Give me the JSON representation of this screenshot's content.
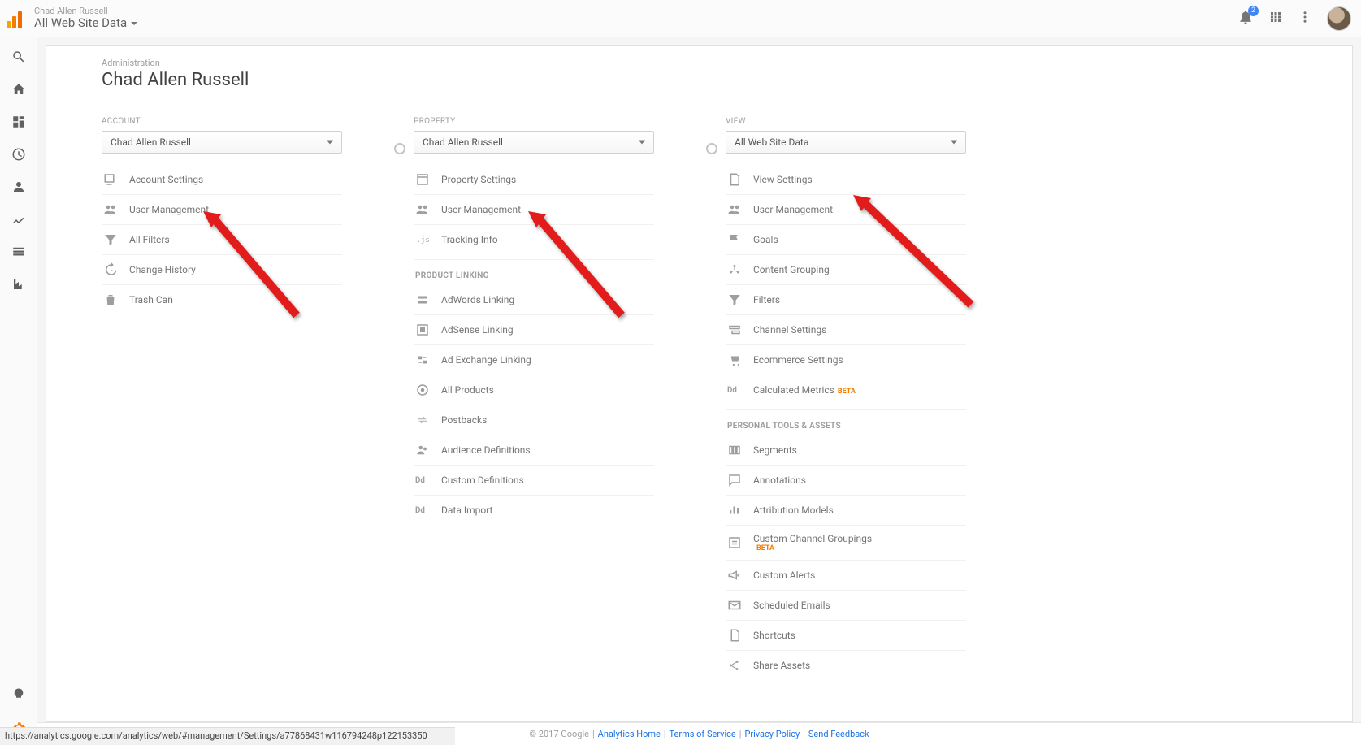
{
  "header": {
    "account_name": "Chad Allen Russell",
    "view_name": "All Web Site Data",
    "notification_count": "2"
  },
  "admin": {
    "breadcrumb": "Administration",
    "title": "Chad Allen Russell"
  },
  "account_col": {
    "label": "ACCOUNT",
    "selector": "Chad Allen Russell",
    "items": [
      {
        "icon": "settings-box",
        "label": "Account Settings"
      },
      {
        "icon": "people",
        "label": "User Management"
      },
      {
        "icon": "filter",
        "label": "All Filters"
      },
      {
        "icon": "history",
        "label": "Change History"
      },
      {
        "icon": "trash",
        "label": "Trash Can"
      }
    ]
  },
  "property_col": {
    "label": "PROPERTY",
    "selector": "Chad Allen Russell",
    "items": [
      {
        "icon": "property-settings",
        "label": "Property Settings"
      },
      {
        "icon": "people",
        "label": "User Management"
      },
      {
        "icon": "code-js",
        "label": "Tracking Info"
      }
    ],
    "section_heading": "PRODUCT LINKING",
    "linking_items": [
      {
        "icon": "adwords",
        "label": "AdWords Linking"
      },
      {
        "icon": "adsense",
        "label": "AdSense Linking"
      },
      {
        "icon": "exchange",
        "label": "Ad Exchange Linking"
      },
      {
        "icon": "all-products",
        "label": "All Products"
      },
      {
        "icon": "postbacks",
        "label": "Postbacks"
      },
      {
        "icon": "audience",
        "label": "Audience Definitions"
      },
      {
        "icon": "dd",
        "label": "Custom Definitions"
      },
      {
        "icon": "dd",
        "label": "Data Import"
      }
    ]
  },
  "view_col": {
    "label": "VIEW",
    "selector": "All Web Site Data",
    "items": [
      {
        "icon": "view-settings",
        "label": "View Settings"
      },
      {
        "icon": "people",
        "label": "User Management"
      },
      {
        "icon": "flag",
        "label": "Goals"
      },
      {
        "icon": "grouping",
        "label": "Content Grouping"
      },
      {
        "icon": "filter",
        "label": "Filters"
      },
      {
        "icon": "channel",
        "label": "Channel Settings"
      },
      {
        "icon": "cart",
        "label": "Ecommerce Settings"
      },
      {
        "icon": "dd",
        "label": "Calculated Metrics",
        "beta": "BETA"
      }
    ],
    "section_heading": "PERSONAL TOOLS & ASSETS",
    "personal_items": [
      {
        "icon": "segments",
        "label": "Segments"
      },
      {
        "icon": "chat",
        "label": "Annotations"
      },
      {
        "icon": "bars",
        "label": "Attribution Models"
      },
      {
        "icon": "channel-box",
        "label": "Custom Channel Groupings",
        "beta": "BETA",
        "beta_block": true
      },
      {
        "icon": "megaphone",
        "label": "Custom Alerts"
      },
      {
        "icon": "envelope",
        "label": "Scheduled Emails"
      },
      {
        "icon": "document",
        "label": "Shortcuts"
      },
      {
        "icon": "share",
        "label": "Share Assets"
      }
    ]
  },
  "footer": {
    "copyright": "© 2017 Google",
    "links": {
      "home": "Analytics Home",
      "terms": "Terms of Service",
      "privacy": "Privacy Policy",
      "feedback": "Send Feedback"
    }
  },
  "status_url": "https://analytics.google.com/analytics/web/#management/Settings/a77868431w116794248p122153350"
}
